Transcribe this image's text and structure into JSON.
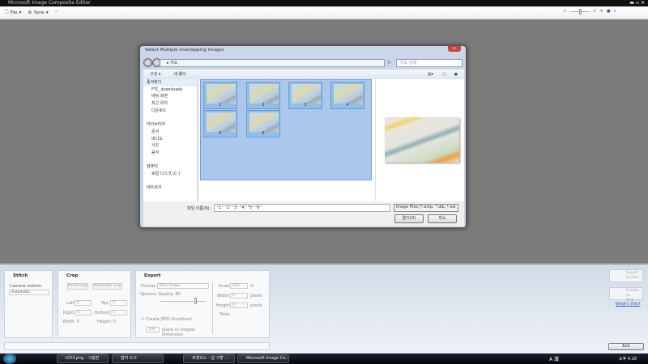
{
  "app": {
    "title": "Microsoft Image Composite Editor"
  },
  "toolbar": {
    "file": "File",
    "tools": "Tools",
    "file_arrow": "▾",
    "tools_arrow": "▾",
    "help_arrow": "▾"
  },
  "dialog": {
    "title": "Select Multiple Overlapping Images",
    "close": "x",
    "address": "▸ 지도",
    "search_placeholder": "지도 검색",
    "organize": "구성 ▾",
    "new_folder": "새 폴더",
    "nav": [
      "즐겨찾기",
      "FTC_downloads",
      "바탕 화면",
      "최근 위치",
      "다운로드",
      "",
      "라이브러리",
      "문서",
      "비디오",
      "사진",
      "음악",
      "",
      "컴퓨터",
      "로컬 디스크 (C:)",
      "",
      "네트워크"
    ],
    "files": [
      "1",
      "2",
      "3",
      "4",
      "5",
      "6"
    ],
    "filename_label": "파일 이름(N):",
    "filename_value": "\"1\" \"2\" \"3\" \"4\" \"5\" \"6\"",
    "filter": "Image Files (*.bmp, *.dib, *.exi",
    "open": "열기(O)",
    "cancel": "취소"
  },
  "stitch": {
    "title": "Stitch",
    "camera_motion_label": "Camera motion:",
    "camera_motion_value": "Automatic"
  },
  "crop": {
    "title": "Crop",
    "reset": "Reset crop",
    "auto": "Automatic crop",
    "left_label": "Left:",
    "left": "0",
    "top_label": "Top:",
    "top": "0",
    "right_label": "Right:",
    "right": "0",
    "bottom_label": "Bottom:",
    "bottom": "0",
    "width": "Width:  0",
    "height": "Height:  0"
  },
  "export": {
    "title": "Export",
    "format_label": "Format:",
    "format": "JPEG Image",
    "quality": "Options: Quality: 80",
    "quality_value": 80,
    "thumb_label": "Create JPEG thumbnail",
    "thumb_px": "100",
    "thumb_text": "pixels in longest dimension",
    "scale_label": "Scale:",
    "scale": "100",
    "pct": "%",
    "width_label": "Width:",
    "width": "0",
    "height_label": "Height:",
    "height": "0",
    "pixels": "pixels",
    "total": "Total:"
  },
  "actions": {
    "export_disk": "Export to disk...",
    "publish": "Publish to Web...",
    "whats_this": "What's this?",
    "exit": "Exit"
  },
  "taskbar": {
    "tasks": [
      "ICE3.png - 그림판",
      "캡처 도구",
      "",
      "포켓도노 - 집 구할 ...",
      "Microsoft Image Co..."
    ],
    "tray": "A 漢",
    "clock": "오후 4:16"
  }
}
